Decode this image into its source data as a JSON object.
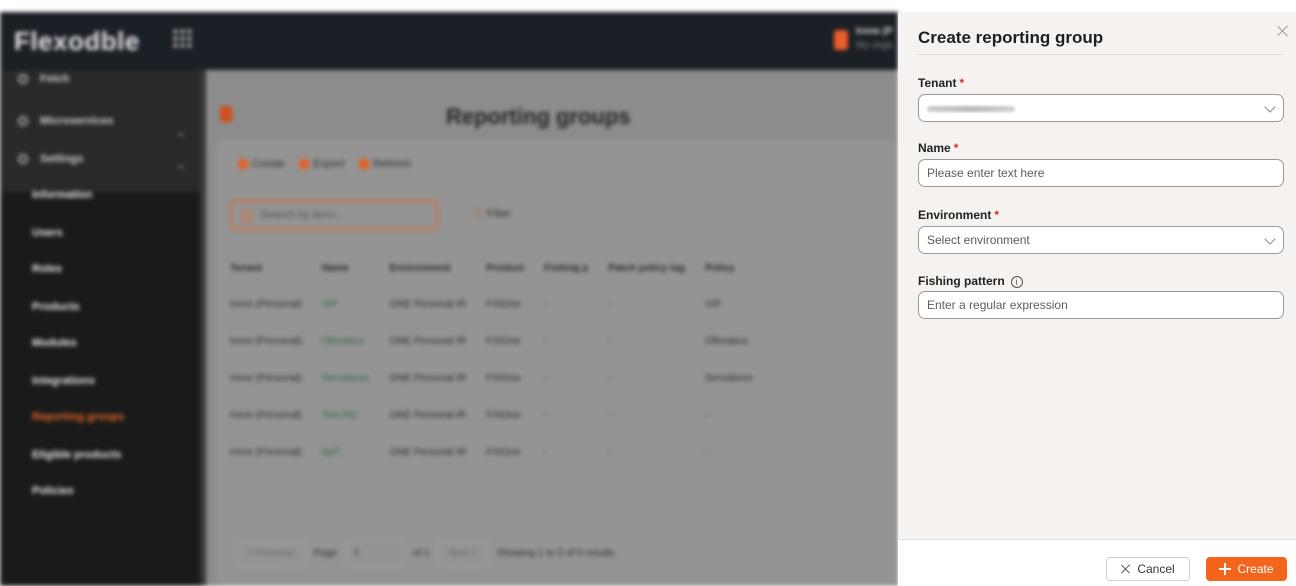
{
  "background_app": {
    "logo": "Flexodble",
    "user": {
      "name": "Irene (P",
      "subtitle": "My orga"
    },
    "sidebar": {
      "top_items": [
        {
          "label": "Fetch"
        },
        {
          "label": "Microservices"
        },
        {
          "label": "Settings"
        }
      ],
      "items": [
        {
          "label": "Information"
        },
        {
          "label": "Users"
        },
        {
          "label": "Roles"
        },
        {
          "label": "Products"
        },
        {
          "label": "Modules"
        },
        {
          "label": "Integrations"
        },
        {
          "label": "Reporting groups"
        },
        {
          "label": "Eligible products"
        },
        {
          "label": "Policies"
        }
      ]
    },
    "page_title": "Reporting groups",
    "toolbar": {
      "create": "Create",
      "export": "Export",
      "refresh": "Refresh"
    },
    "search_placeholder": "Search by term...",
    "filter_label": "Filter",
    "table": {
      "headers": [
        "Tenant",
        "Name",
        "Environment",
        "Product",
        "Fishing p",
        "Patch policy tag",
        "Policy"
      ],
      "rows": [
        [
          "Irene (Personal)",
          "VIP",
          "ONE Personal IR",
          "FXIOne",
          "-",
          "-",
          "VIP"
        ],
        [
          "Irene (Personal)",
          "Ofimatica",
          "ONE Personal IR",
          "FXIOne",
          "-",
          "-",
          "Ofimatica"
        ],
        [
          "Irene (Personal)",
          "Servidores",
          "ONE Personal IR",
          "FXIOne",
          "-",
          "-",
          "Servidores"
        ],
        [
          "Irene (Personal)",
          "Test RG",
          "ONE Personal IR",
          "FXIOne",
          "-",
          "-",
          "-"
        ],
        [
          "Irene (Personal)",
          "hpIT",
          "ONE Personal IR",
          "FXIOne",
          "-",
          "-",
          "-"
        ]
      ]
    },
    "pager": {
      "prev": "< Previous",
      "page_label": "Page",
      "page": "1",
      "of": "of 1",
      "next": "Next >",
      "summary": "Showing 1 to 5 of 5 results"
    }
  },
  "drawer": {
    "title": "Create reporting group",
    "fields": {
      "tenant": {
        "label": "Tenant",
        "required_mark": "*"
      },
      "name": {
        "label": "Name",
        "required_mark": "*",
        "placeholder": "Please enter text here"
      },
      "environment": {
        "label": "Environment",
        "required_mark": "*",
        "placeholder": "Select environment"
      },
      "fishing_pattern": {
        "label": "Fishing pattern",
        "info_icon": "i",
        "placeholder": "Enter a regular expression"
      }
    },
    "footer": {
      "cancel": "Cancel",
      "create": "Create"
    }
  },
  "colors": {
    "accent": "#f2651b",
    "drawer_bg": "#f5f2ef",
    "required": "#d32f2f"
  },
  "icons": [
    "apps-grid-icon",
    "close-icon",
    "chevron-down-icon",
    "info-icon",
    "plus-icon",
    "x-icon"
  ]
}
